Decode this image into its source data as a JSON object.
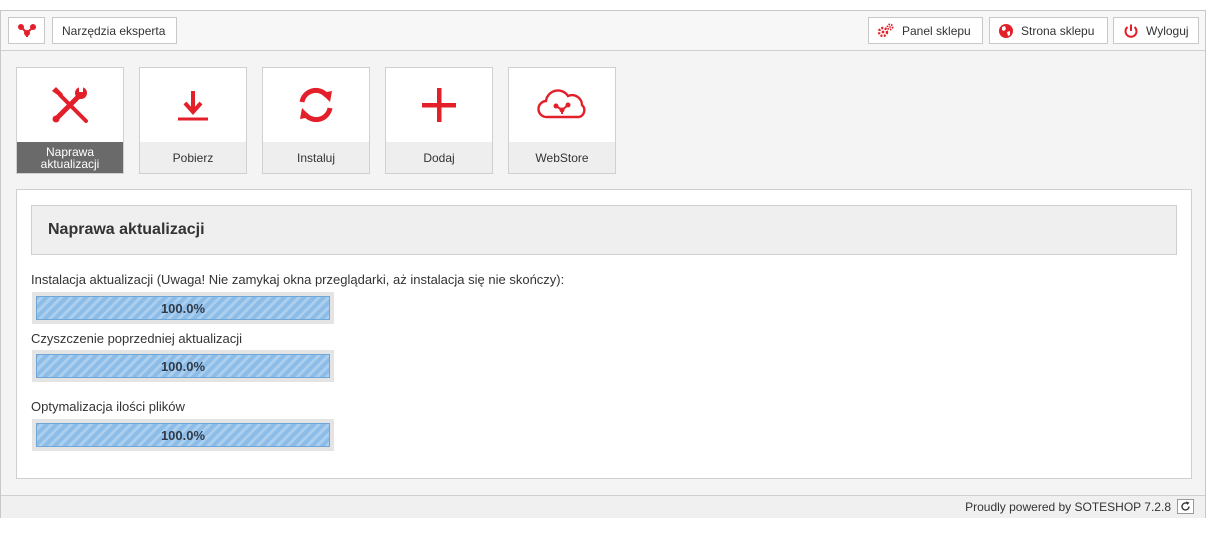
{
  "colors": {
    "accent": "#e3202a",
    "active_tile_label_bg": "#6a6a6a",
    "progress_fill": "#8cbce8"
  },
  "topbar": {
    "logo_icon": "soteshop-logo-icon",
    "expert_tools_label": "Narzędzia eksperta",
    "right_buttons": [
      {
        "label": "Panel sklepu",
        "icon": "gears-icon"
      },
      {
        "label": "Strona sklepu",
        "icon": "globe-icon"
      },
      {
        "label": "Wyloguj",
        "icon": "power-icon"
      }
    ]
  },
  "tiles": [
    {
      "label": "Naprawa aktualizacji",
      "icon": "wrench-screwdriver-icon",
      "active": true
    },
    {
      "label": "Pobierz",
      "icon": "download-icon",
      "active": false
    },
    {
      "label": "Instaluj",
      "icon": "refresh-icon",
      "active": false
    },
    {
      "label": "Dodaj",
      "icon": "plus-icon",
      "active": false
    },
    {
      "label": "WebStore",
      "icon": "cloud-icon",
      "active": false
    }
  ],
  "section": {
    "title": "Naprawa aktualizacji",
    "tasks": [
      {
        "label": "Instalacja aktualizacji (Uwaga! Nie zamykaj okna przeglądarki, aż instalacja się nie skończy):",
        "progress": 1.0,
        "progress_text": "100.0%"
      },
      {
        "label": "Czyszczenie poprzedniej aktualizacji",
        "progress": 1.0,
        "progress_text": "100.0%"
      },
      {
        "label": "Optymalizacja ilości plików",
        "progress": 1.0,
        "progress_text": "100.0%"
      }
    ]
  },
  "footer": {
    "powered_by": "Proudly powered by SOTESHOP 7.2.8",
    "refresh_icon": "refresh-small-icon"
  }
}
